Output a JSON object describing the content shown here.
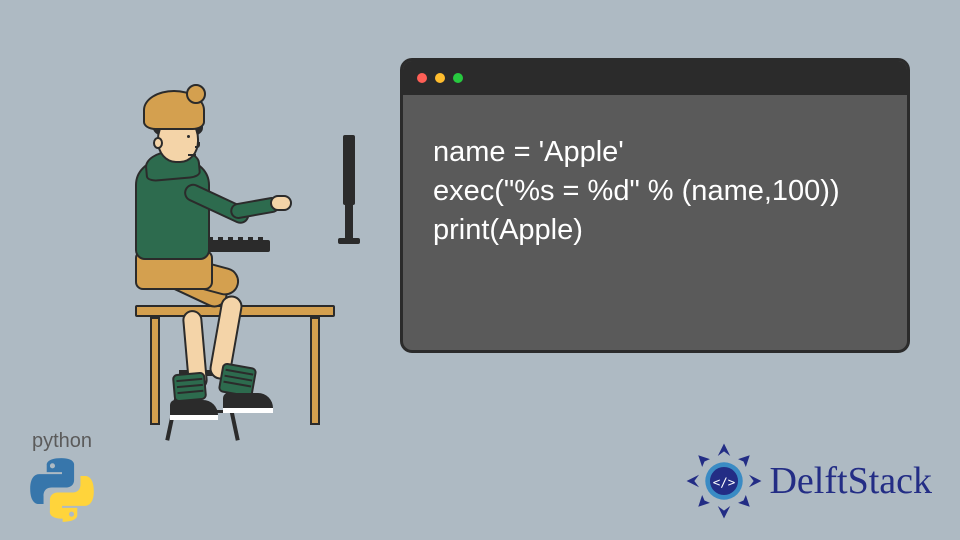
{
  "code": {
    "line1": "name = 'Apple'",
    "line2": "exec(\"%s = %d\" % (name,100))",
    "line3": "print(Apple)"
  },
  "window": {
    "dots": {
      "red": "#ff5f56",
      "yellow": "#ffbd2e",
      "green": "#27c93f"
    }
  },
  "logos": {
    "python_label": "python",
    "delft_label": "DelftStack"
  },
  "illustration": {
    "subject": "person-at-desk-coding",
    "palette": {
      "hoodie": "#2d6b4e",
      "shorts": "#d4a04f",
      "skin": "#f4d4a8",
      "outline": "#2b2b2b"
    }
  }
}
